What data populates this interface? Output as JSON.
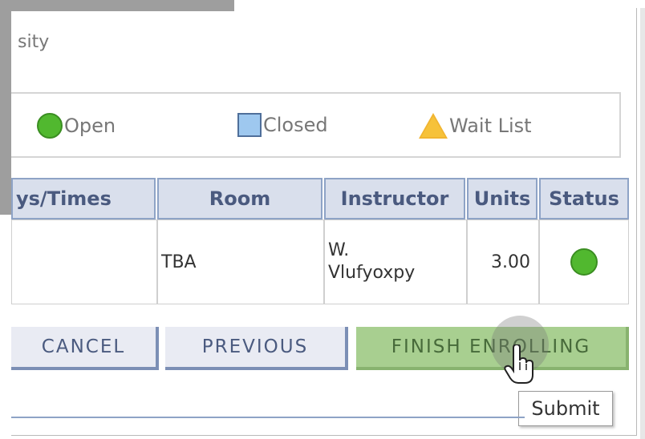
{
  "header": {
    "university_fragment": "sity"
  },
  "legend": {
    "open": "Open",
    "closed": "Closed",
    "wait_list": "Wait List",
    "icons": [
      "open-circle-icon",
      "closed-square-icon",
      "wait-list-triangle-icon"
    ],
    "colors": {
      "open": "#51b82f",
      "closed": "#9ec8ef",
      "wait": "#f1b531"
    }
  },
  "table": {
    "headers": [
      "ys/Times",
      "Room",
      "Instructor",
      "Units",
      "Status"
    ],
    "rows": [
      {
        "days_times": "",
        "room": "TBA",
        "instructor": "W. Vlufyoxpy",
        "units": "3.00",
        "status": "open-circle-icon"
      }
    ]
  },
  "buttons": {
    "cancel": "Cancel",
    "previous": "Previous",
    "finish": "Finish Enrolling"
  },
  "tooltip": "Submit",
  "colors": {
    "header_bg": "#d9dfec",
    "finish_bg": "#a8cf90"
  }
}
